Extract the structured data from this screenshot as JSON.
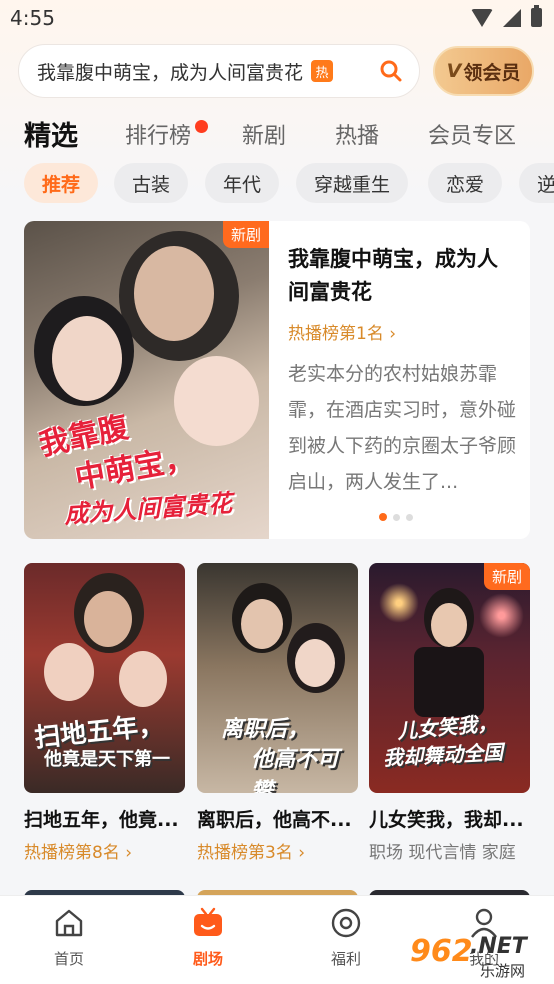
{
  "status": {
    "time": "4:55"
  },
  "search": {
    "query": "我靠腹中萌宝，成为人间富贵花",
    "hot_tag": "热"
  },
  "vip": {
    "label": "领会员"
  },
  "tabs": [
    "精选",
    "排行榜",
    "新剧",
    "热播",
    "会员专区"
  ],
  "chips": [
    "推荐",
    "古装",
    "年代",
    "穿越重生",
    "恋爱",
    "逆"
  ],
  "feature": {
    "badge": "新剧",
    "poster_title_1": "我靠腹",
    "poster_title_2": "中萌宝，",
    "poster_title_3": "成为人间富贵花",
    "title": "我靠腹中萌宝，成为人间富贵花",
    "rank": "热播榜第1名",
    "description": "老实本分的农村姑娘苏霏霏，在酒店实习时，意外碰到被人下药的京圈太子爷顾启山，两人发生了..."
  },
  "cards": [
    {
      "title": "扫地五年，他竟...",
      "sub": "热播榜第8名",
      "cover_text_1": "扫地五年，",
      "cover_text_2": "他竟是天下第一"
    },
    {
      "title": "离职后，他高不...",
      "sub": "热播榜第3名",
      "cover_text_1": "离职后，",
      "cover_text_2": "他高不可攀"
    },
    {
      "title": "儿女笑我，我却...",
      "sub": "职场  现代言情  家庭",
      "badge": "新剧",
      "cover_text_1": "儿女笑我，",
      "cover_text_2": "我却舞动全国"
    }
  ],
  "nav": [
    "首页",
    "剧场",
    "福利",
    "我的"
  ],
  "watermark": {
    "text": "962",
    "net": ".NET",
    "site": "乐游网"
  },
  "colors": {
    "accent": "#ff6a19",
    "rank": "#d88a2a",
    "vip": "#e9a867"
  }
}
